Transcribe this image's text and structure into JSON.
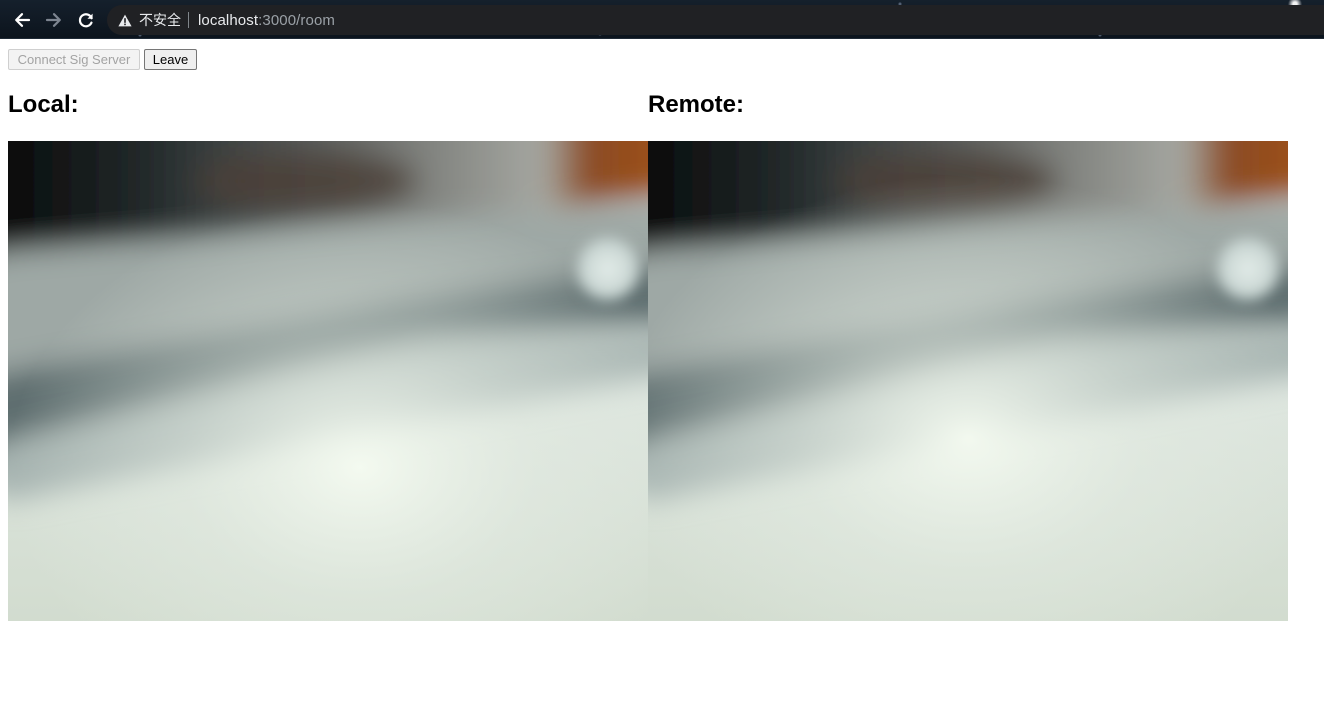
{
  "browser": {
    "security_label": "不安全",
    "url_host": "localhost",
    "url_rest": ":3000/room",
    "icons": {
      "back": "arrow-left-icon",
      "forward": "arrow-right-icon",
      "reload": "reload-icon",
      "security": "warning-triangle-icon"
    }
  },
  "controls": {
    "connect_label": "Connect Sig Server",
    "connect_disabled": true,
    "leave_label": "Leave"
  },
  "local": {
    "heading": "Local:"
  },
  "remote": {
    "heading": "Remote:"
  },
  "colors": {
    "page_background": "#ffffff",
    "omnibox": "#202124",
    "disabled_text": "#a3a3a3"
  }
}
